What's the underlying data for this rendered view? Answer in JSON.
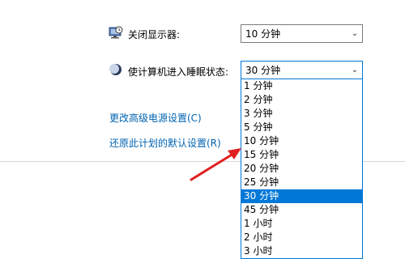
{
  "display": {
    "label": "关闭显示器:",
    "selected": "10 分钟",
    "icon": "monitor-clock-icon"
  },
  "sleep": {
    "label": "使计算机进入睡眠状态:",
    "selected": "30 分钟",
    "icon": "moon-icon",
    "options": [
      "1 分钟",
      "2 分钟",
      "3 分钟",
      "5 分钟",
      "10 分钟",
      "15 分钟",
      "20 分钟",
      "25 分钟",
      "30 分钟",
      "45 分钟",
      "1 小时",
      "2 小时",
      "3 小时"
    ]
  },
  "links": {
    "advanced": "更改高级电源设置(C)",
    "restore": "还原此计划的默认设置(R)"
  },
  "colors": {
    "accent": "#0078d7",
    "link": "#0063b1",
    "annotation_arrow": "#e02020"
  }
}
